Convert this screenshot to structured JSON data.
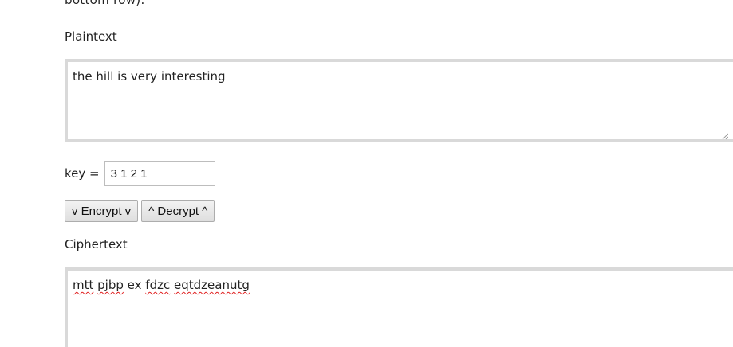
{
  "intro": {
    "cut_text": "bottom row)."
  },
  "plaintext": {
    "label": "Plaintext",
    "value": "the hill is very interesting"
  },
  "key": {
    "label": "key =",
    "value": "3 1 2 1"
  },
  "buttons": {
    "encrypt_label": "v Encrypt v",
    "decrypt_label": "^ Decrypt ^"
  },
  "ciphertext": {
    "label": "Ciphertext",
    "words": [
      "mtt",
      "pjbp",
      "ex",
      "fdzc",
      "eqtdzeanutg"
    ],
    "misspelled": [
      true,
      true,
      false,
      true,
      true
    ]
  }
}
